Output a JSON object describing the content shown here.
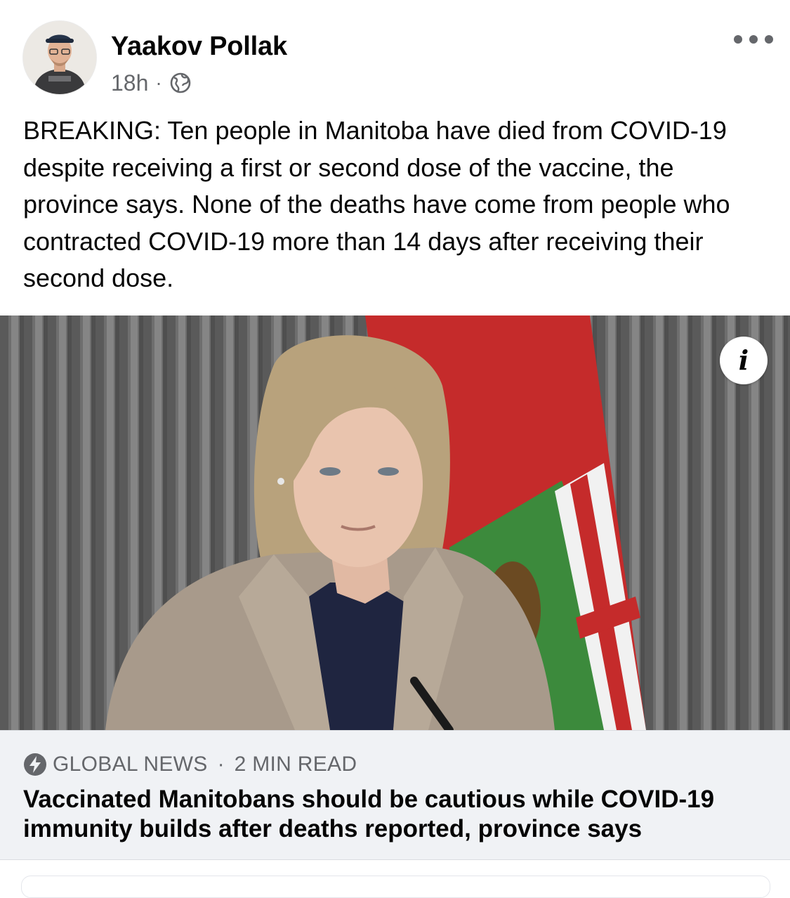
{
  "post": {
    "author_name": "Yaakov Pollak",
    "timestamp": "18h",
    "separator": "·",
    "audience_icon": "globe-icon",
    "menu_icon": "more-options-icon",
    "text": "BREAKING: Ten people in Manitoba have died from COVID-19 despite receiving a first or second dose of the vaccine, the province says. None of the deaths have come from people who contracted COVID-19 more than 14 days after receiving their second dose."
  },
  "link": {
    "image_info_icon": "info-icon",
    "info_glyph": "i",
    "source_icon": "instant-article-bolt-icon",
    "source": "GLOBAL NEWS",
    "separator": "·",
    "read_time": "2 MIN READ",
    "headline": "Vaccinated Manitobans should be cautious while COVID-19 immunity builds after deaths reported, province says"
  },
  "colors": {
    "text_primary": "#050505",
    "text_secondary": "#65676b",
    "preview_background": "#f0f2f5",
    "flag_red": "#c52b2b",
    "flag_green": "#3c8a3c"
  }
}
